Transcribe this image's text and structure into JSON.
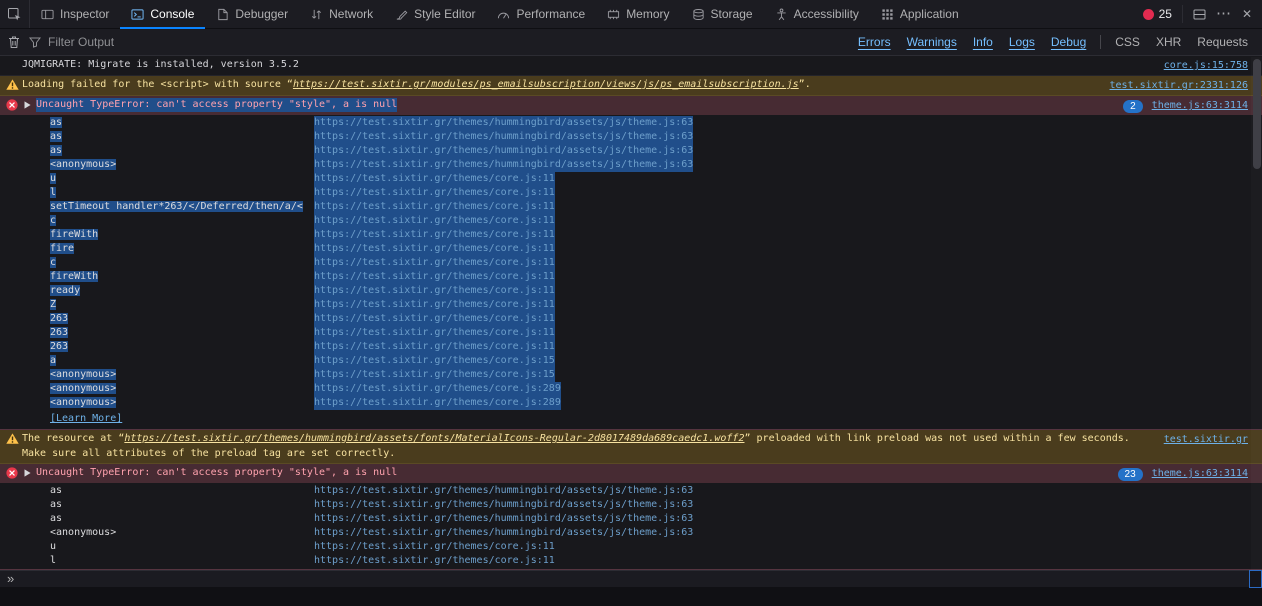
{
  "colors": {
    "accent": "#0a84ff",
    "link": "#6eb1e8",
    "warning_bg": "#4a3c1d",
    "warning_text": "#f7e2a0",
    "error_bg": "#472b33",
    "error_text": "#ffa2ae",
    "selection_bg": "#204e8a",
    "badge_bg": "#2472c8",
    "error_dot": "#e22b50"
  },
  "tabbar": {
    "pick_icon": "pick-element-icon",
    "tabs": [
      {
        "label": "Inspector",
        "icon": "inspector-icon",
        "active": false
      },
      {
        "label": "Console",
        "icon": "console-icon",
        "active": true
      },
      {
        "label": "Debugger",
        "icon": "debugger-icon",
        "active": false
      },
      {
        "label": "Network",
        "icon": "network-icon",
        "active": false
      },
      {
        "label": "Style Editor",
        "icon": "style-editor-icon",
        "active": false
      },
      {
        "label": "Performance",
        "icon": "performance-icon",
        "active": false
      },
      {
        "label": "Memory",
        "icon": "memory-icon",
        "active": false
      },
      {
        "label": "Storage",
        "icon": "storage-icon",
        "active": false
      },
      {
        "label": "Accessibility",
        "icon": "accessibility-icon",
        "active": false
      },
      {
        "label": "Application",
        "icon": "application-icon",
        "active": false
      }
    ],
    "error_count": "25",
    "controls": [
      {
        "icon": "split-console-icon"
      },
      {
        "icon": "meatball-menu-icon"
      },
      {
        "icon": "close-icon"
      }
    ]
  },
  "console_toolbar": {
    "clear_icon": "trash-icon",
    "filter_icon": "funnel-icon",
    "filter_placeholder": "Filter Output",
    "filters": [
      {
        "label": "Errors",
        "enabled": true
      },
      {
        "label": "Warnings",
        "enabled": true
      },
      {
        "label": "Info",
        "enabled": true
      },
      {
        "label": "Logs",
        "enabled": true
      },
      {
        "label": "Debug",
        "enabled": true
      },
      {
        "label": "CSS",
        "enabled": false,
        "divider_before": true
      },
      {
        "label": "XHR",
        "enabled": false
      },
      {
        "label": "Requests",
        "enabled": false
      }
    ]
  },
  "console": {
    "expand_more": "»",
    "messages": [
      {
        "type": "log",
        "text": "JQMIGRATE: Migrate is installed, version 3.5.2",
        "source": "core.js:15:758"
      },
      {
        "type": "warn",
        "parts": [
          {
            "text": "Loading failed for the <script> with source “"
          },
          {
            "text": "https://test.sixtir.gr/modules/ps_emailsubscription/views/js/ps_emailsubscription.js",
            "link": true
          },
          {
            "text": "”."
          }
        ],
        "source": "test.sixtir.gr:2331:126"
      },
      {
        "type": "error",
        "text": "Uncaught TypeError: can't access property \"style\", a is null",
        "badge": "2",
        "source": "theme.js:63:3114",
        "selected": true,
        "learn_more": "[Learn More]",
        "stack": [
          {
            "fn": "as",
            "url": "https://test.sixtir.gr/themes/hummingbird/assets/js/theme.js:63"
          },
          {
            "fn": "as",
            "url": "https://test.sixtir.gr/themes/hummingbird/assets/js/theme.js:63"
          },
          {
            "fn": "as",
            "url": "https://test.sixtir.gr/themes/hummingbird/assets/js/theme.js:63"
          },
          {
            "fn": "<anonymous>",
            "url": "https://test.sixtir.gr/themes/hummingbird/assets/js/theme.js:63"
          },
          {
            "fn": "u",
            "url": "https://test.sixtir.gr/themes/core.js:11"
          },
          {
            "fn": "l",
            "url": "https://test.sixtir.gr/themes/core.js:11"
          },
          {
            "fn": "setTimeout handler*263/</Deferred/then/a/<",
            "url": "https://test.sixtir.gr/themes/core.js:11"
          },
          {
            "fn": "c",
            "url": "https://test.sixtir.gr/themes/core.js:11"
          },
          {
            "fn": "fireWith",
            "url": "https://test.sixtir.gr/themes/core.js:11"
          },
          {
            "fn": "fire",
            "url": "https://test.sixtir.gr/themes/core.js:11"
          },
          {
            "fn": "c",
            "url": "https://test.sixtir.gr/themes/core.js:11"
          },
          {
            "fn": "fireWith",
            "url": "https://test.sixtir.gr/themes/core.js:11"
          },
          {
            "fn": "ready",
            "url": "https://test.sixtir.gr/themes/core.js:11"
          },
          {
            "fn": "Z",
            "url": "https://test.sixtir.gr/themes/core.js:11"
          },
          {
            "fn": "263",
            "url": "https://test.sixtir.gr/themes/core.js:11"
          },
          {
            "fn": "263",
            "url": "https://test.sixtir.gr/themes/core.js:11"
          },
          {
            "fn": "263",
            "url": "https://test.sixtir.gr/themes/core.js:11"
          },
          {
            "fn": "a",
            "url": "https://test.sixtir.gr/themes/core.js:15"
          },
          {
            "fn": "<anonymous>",
            "url": "https://test.sixtir.gr/themes/core.js:15"
          },
          {
            "fn": "<anonymous>",
            "url": "https://test.sixtir.gr/themes/core.js:289"
          },
          {
            "fn": "<anonymous>",
            "url": "https://test.sixtir.gr/themes/core.js:289"
          }
        ]
      },
      {
        "type": "warn",
        "parts": [
          {
            "text": "The resource at “"
          },
          {
            "text": "https://test.sixtir.gr/themes/hummingbird/assets/fonts/MaterialIcons-Regular-2d8017489da689caedc1.woff2",
            "link": true
          },
          {
            "text": "” preloaded with link preload was not used within a few seconds."
          }
        ],
        "line2": "Make sure all attributes of the preload tag are set correctly.",
        "source": "test.sixtir.gr"
      },
      {
        "type": "error",
        "text": "Uncaught TypeError: can't access property \"style\", a is null",
        "badge": "23",
        "source": "theme.js:63:3114",
        "selected": false,
        "stack": [
          {
            "fn": "as",
            "url": "https://test.sixtir.gr/themes/hummingbird/assets/js/theme.js:63"
          },
          {
            "fn": "as",
            "url": "https://test.sixtir.gr/themes/hummingbird/assets/js/theme.js:63"
          },
          {
            "fn": "as",
            "url": "https://test.sixtir.gr/themes/hummingbird/assets/js/theme.js:63"
          },
          {
            "fn": "<anonymous>",
            "url": "https://test.sixtir.gr/themes/hummingbird/assets/js/theme.js:63"
          },
          {
            "fn": "u",
            "url": "https://test.sixtir.gr/themes/core.js:11"
          },
          {
            "fn": "l",
            "url": "https://test.sixtir.gr/themes/core.js:11"
          }
        ]
      }
    ]
  }
}
